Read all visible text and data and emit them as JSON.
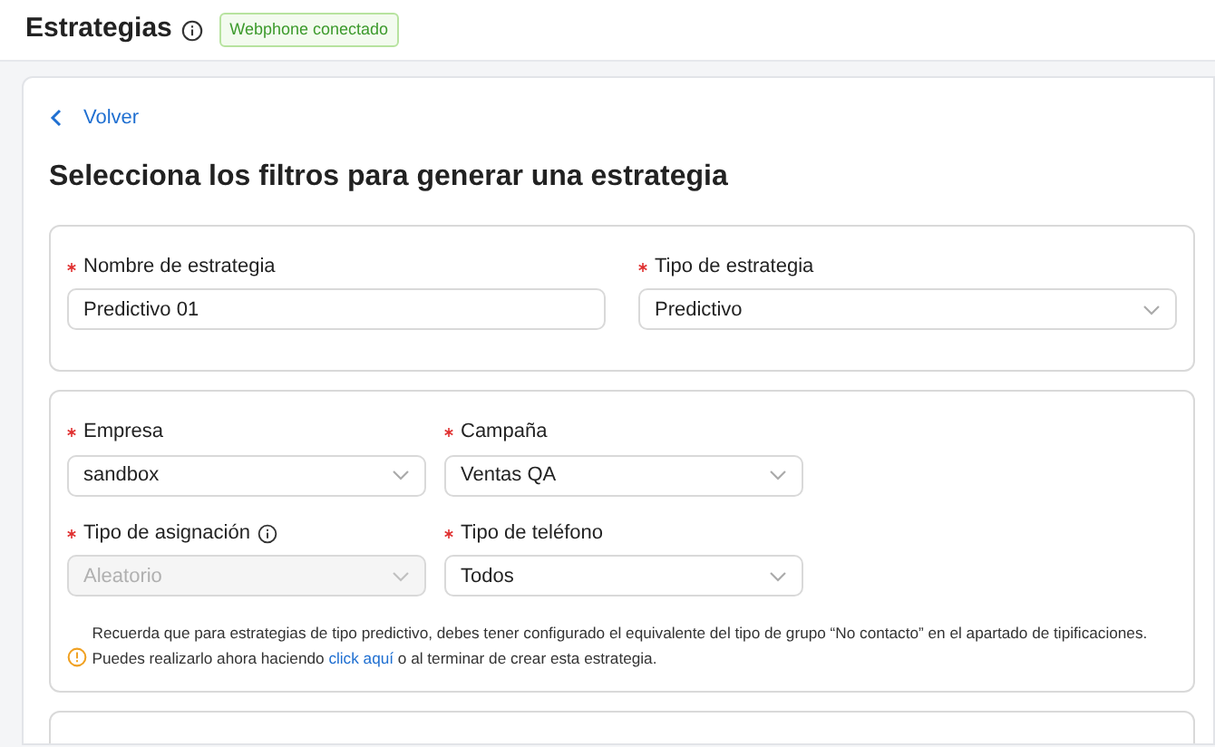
{
  "header": {
    "title": "Estrategias",
    "badge": "Webphone conectado"
  },
  "back_link": "Volver",
  "heading": "Selecciona los filtros para generar una estrategia",
  "sections": [
    {
      "fields": [
        {
          "label": "Nombre de estrategia",
          "kind": "text",
          "value": "Predictivo 01",
          "required": true,
          "disabled": false,
          "info": false
        },
        {
          "label": "Tipo de estrategia",
          "kind": "select",
          "value": "Predictivo",
          "required": true,
          "disabled": false,
          "info": false
        }
      ]
    },
    {
      "fields": [
        {
          "label": "Empresa",
          "kind": "select",
          "value": "sandbox",
          "required": true,
          "disabled": false,
          "info": false
        },
        {
          "label": "Campaña",
          "kind": "select",
          "value": "Ventas QA",
          "required": true,
          "disabled": false,
          "info": false
        },
        {
          "label": "Tipo de asignación",
          "kind": "select",
          "value": "Aleatorio",
          "required": true,
          "disabled": true,
          "info": true
        },
        {
          "label": "Tipo de teléfono",
          "kind": "select",
          "value": "Todos",
          "required": true,
          "disabled": false,
          "info": false
        }
      ],
      "notice": {
        "line_1": "Recuerda que para estrategias de tipo predictivo, debes tener configurado el equivalente del tipo de grupo “No contacto” en el apartado de tipificaciones.",
        "line_2_before": "Puedes realizarlo ahora haciendo",
        "link": "click aquí",
        "line_2_after": "o al terminar de crear esta estrategia."
      }
    }
  ]
}
